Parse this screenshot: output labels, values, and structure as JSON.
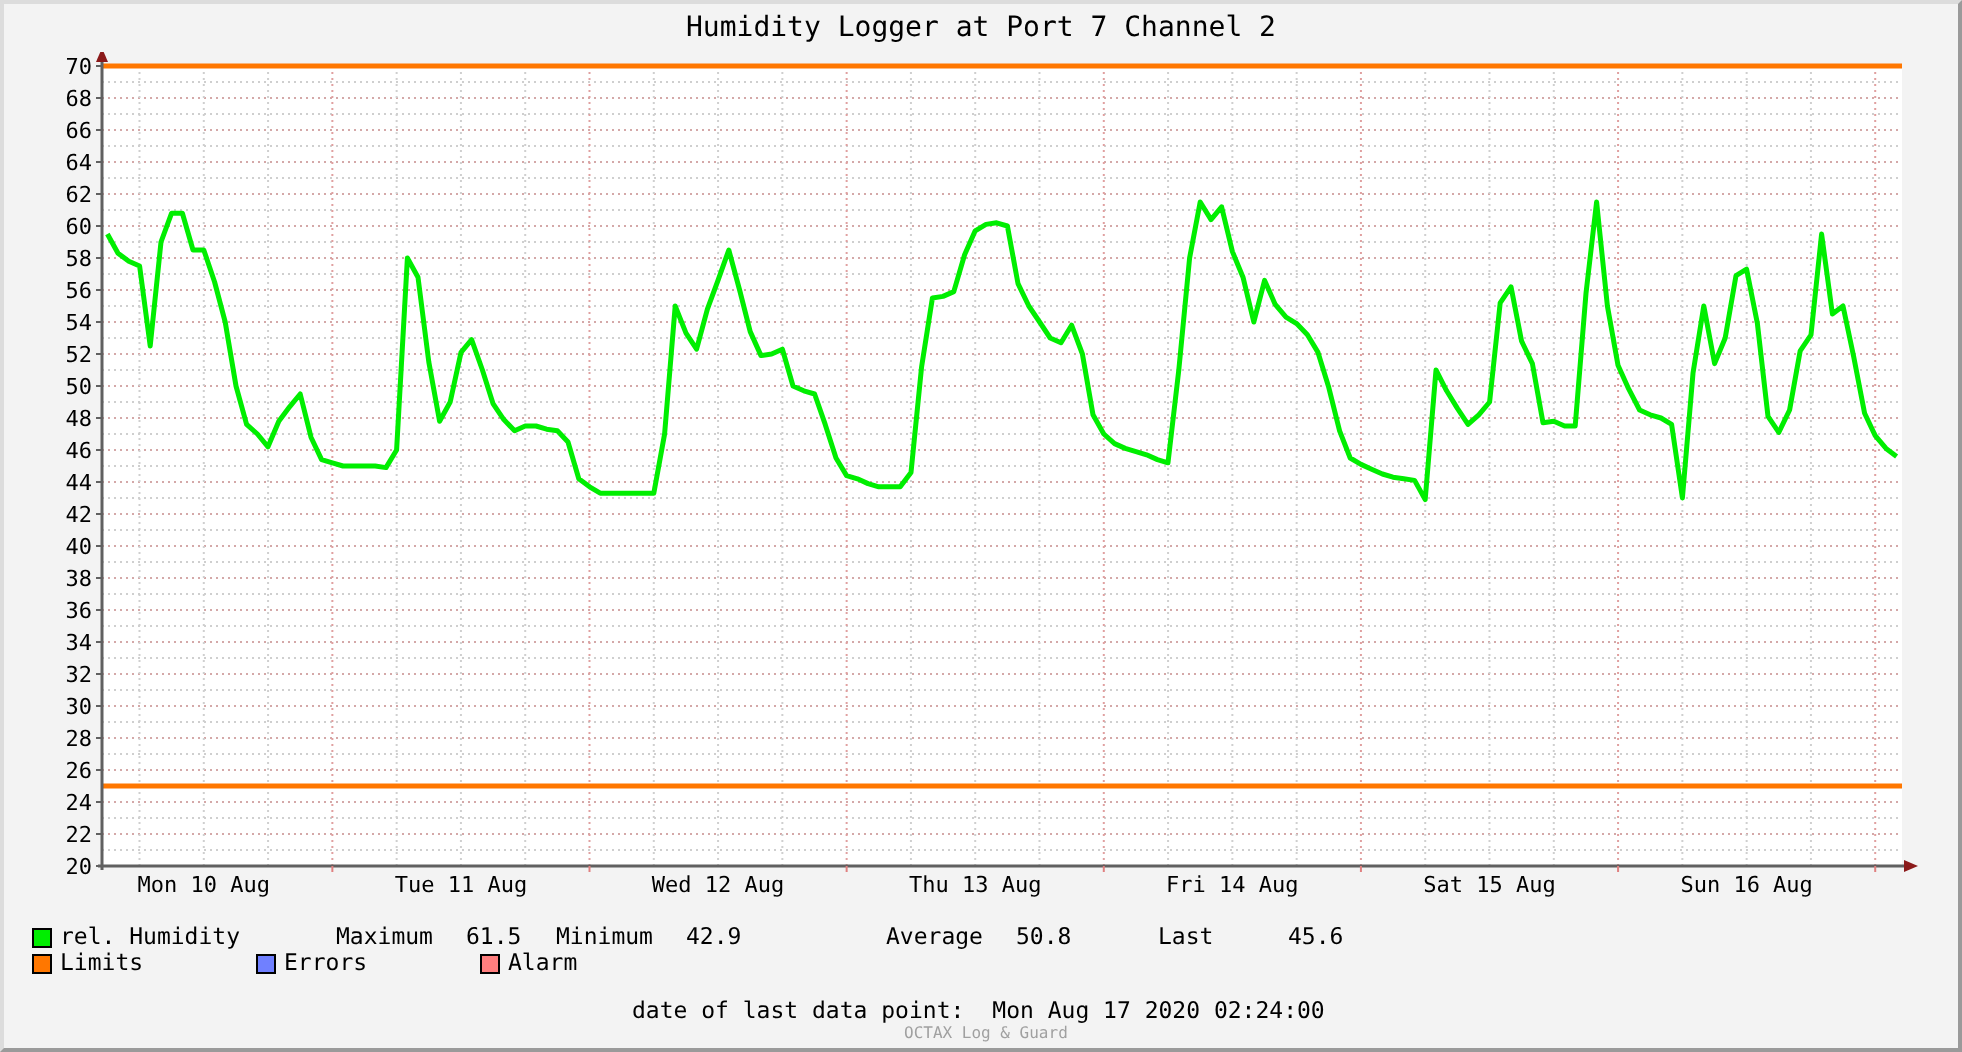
{
  "chart_data": {
    "type": "line",
    "title": "Humidity Logger at Port 7 Channel 2",
    "ylim": [
      20,
      70
    ],
    "yticks": [
      20,
      22,
      24,
      26,
      28,
      30,
      32,
      34,
      36,
      38,
      40,
      42,
      44,
      46,
      48,
      50,
      52,
      54,
      56,
      58,
      60,
      62,
      64,
      66,
      68,
      70
    ],
    "categories": [
      null,
      null,
      null,
      null,
      null,
      null,
      null,
      null,
      null,
      "Mon 10 Aug",
      null,
      null,
      null,
      null,
      null,
      null,
      null,
      null,
      null,
      null,
      null,
      null,
      null,
      null,
      null,
      null,
      null,
      null,
      null,
      null,
      null,
      null,
      null,
      "Tue 11 Aug",
      null,
      null,
      null,
      null,
      null,
      null,
      null,
      null,
      null,
      null,
      null,
      null,
      null,
      null,
      null,
      null,
      null,
      null,
      null,
      null,
      null,
      null,
      null,
      "Wed 12 Aug",
      null,
      null,
      null,
      null,
      null,
      null,
      null,
      null,
      null,
      null,
      null,
      null,
      null,
      null,
      null,
      null,
      null,
      null,
      null,
      null,
      null,
      null,
      null,
      "Thu 13 Aug",
      null,
      null,
      null,
      null,
      null,
      null,
      null,
      null,
      null,
      null,
      null,
      null,
      null,
      null,
      null,
      null,
      null,
      null,
      null,
      null,
      null,
      null,
      null,
      "Fri 14 Aug",
      null,
      null,
      null,
      null,
      null,
      null,
      null,
      null,
      null,
      null,
      null,
      null,
      null,
      null,
      null,
      null,
      null,
      null,
      null,
      null,
      null,
      null,
      null,
      "Sat 15 Aug",
      null,
      null,
      null,
      null,
      null,
      null,
      null,
      null,
      null,
      null,
      null,
      null,
      null,
      null,
      null,
      null,
      null,
      null,
      null,
      null,
      null,
      null,
      null,
      "Sun 16 Aug",
      null,
      null,
      null,
      null,
      null,
      null,
      null,
      null,
      null,
      null,
      null,
      null,
      null,
      null
    ],
    "series": [
      {
        "name": "rel. Humidity",
        "color": "#00ee00",
        "values": [
          59.5,
          58.3,
          57.8,
          57.5,
          52.5,
          59,
          60.8,
          60.8,
          58.5,
          58.5,
          56.5,
          54,
          50,
          47.6,
          47,
          46.2,
          47.8,
          48.7,
          49.5,
          46.8,
          45.4,
          45.2,
          45,
          45,
          45,
          45,
          44.9,
          46,
          58,
          56.8,
          51.5,
          47.8,
          49,
          52.1,
          52.9,
          51,
          48.9,
          47.9,
          47.2,
          47.5,
          47.5,
          47.3,
          47.2,
          46.5,
          44.2,
          43.7,
          43.3,
          43.3,
          43.3,
          43.3,
          43.3,
          43.3,
          47,
          55,
          53.3,
          52.3,
          54.8,
          56.6,
          58.5,
          56,
          53.4,
          51.9,
          52,
          52.3,
          50,
          49.7,
          49.5,
          47.6,
          45.5,
          44.4,
          44.2,
          43.9,
          43.7,
          43.7,
          43.7,
          44.6,
          51.2,
          55.5,
          55.6,
          55.9,
          58.2,
          59.7,
          60.1,
          60.2,
          60,
          56.4,
          55,
          54,
          53,
          52.7,
          53.8,
          52,
          48.2,
          47,
          46.4,
          46.1,
          45.9,
          45.7,
          45.4,
          45.2,
          51,
          58,
          61.5,
          60.4,
          61.2,
          58.4,
          56.8,
          54,
          56.6,
          55.1,
          54.3,
          53.9,
          53.2,
          52.1,
          49.9,
          47.2,
          45.5,
          45.1,
          44.8,
          44.5,
          44.3,
          44.2,
          44.1,
          42.9,
          51,
          49.7,
          48.6,
          47.6,
          48.2,
          49,
          55.2,
          56.2,
          52.8,
          51.4,
          47.7,
          47.8,
          47.5,
          47.5,
          55.8,
          61.5,
          55,
          51.3,
          49.8,
          48.5,
          48.2,
          48,
          47.6,
          43,
          50.8,
          55,
          51.4,
          53,
          56.9,
          57.3,
          53.9,
          48.1,
          47.1,
          48.5,
          52.2,
          53.2,
          59.5,
          54.5,
          55,
          51.8,
          48.3,
          46.9,
          46.1,
          45.6
        ]
      }
    ],
    "ref_lines": [
      {
        "axis": "y",
        "value": 70
      },
      {
        "axis": "y",
        "value": 25
      }
    ],
    "grid": true
  },
  "stats": [
    {
      "label": "Maximum",
      "value": "61.5"
    },
    {
      "label": "Minimum",
      "value": "42.9"
    },
    {
      "label": "Average",
      "value": "50.8"
    },
    {
      "label": "Last",
      "value": "45.6"
    }
  ],
  "legend": [
    {
      "label": "Limits",
      "color": "#ff7700"
    },
    {
      "label": "Errors",
      "color": "#7080ff"
    },
    {
      "label": "Alarm",
      "color": "#ff7f7f"
    }
  ],
  "last_data_point": {
    "label": "date of last data point:",
    "value": "Mon Aug 17 2020 02:24:00"
  },
  "footer": "OCTAX Log & Guard"
}
